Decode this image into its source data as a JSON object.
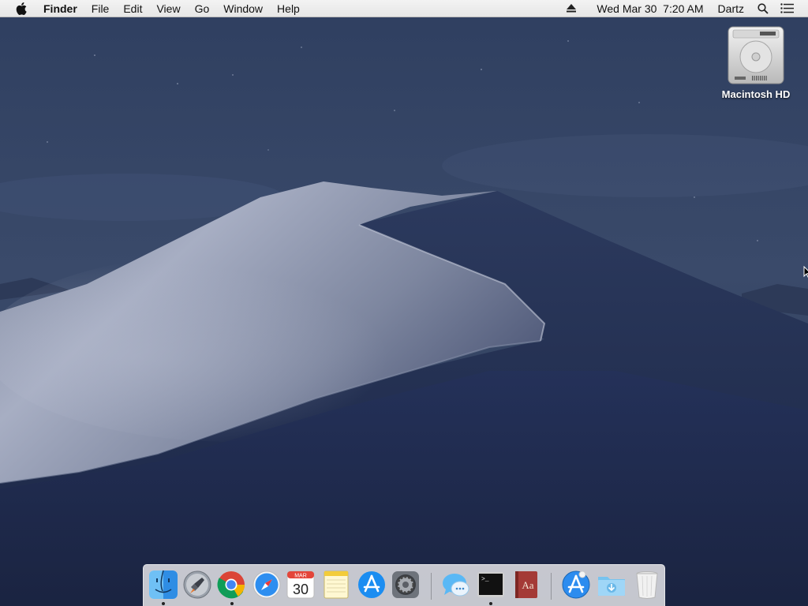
{
  "menubar": {
    "app_name": "Finder",
    "menus": [
      "File",
      "Edit",
      "View",
      "Go",
      "Window",
      "Help"
    ],
    "clock": "Wed Mar 30  7:20 AM",
    "user": "Dartz",
    "icons": [
      "apple-icon",
      "eject-icon",
      "spotlight-search-icon",
      "notification-center-icon"
    ]
  },
  "desktop": {
    "hd_label": "Macintosh HD"
  },
  "dock": {
    "apps": [
      {
        "name": "finder-icon",
        "running": true
      },
      {
        "name": "launchpad-icon",
        "running": false
      },
      {
        "name": "chrome-icon",
        "running": true
      },
      {
        "name": "safari-icon",
        "running": false
      },
      {
        "name": "calendar-icon",
        "running": false
      },
      {
        "name": "notes-icon",
        "running": false
      },
      {
        "name": "app-store-icon",
        "running": false
      },
      {
        "name": "system-preferences-icon",
        "running": false
      },
      {
        "name": "messages-icon",
        "running": false
      },
      {
        "name": "terminal-icon",
        "running": true
      },
      {
        "name": "dictionary-icon",
        "running": false
      },
      {
        "name": "applications-folder-icon",
        "running": false
      },
      {
        "name": "downloads-folder-icon",
        "running": false
      },
      {
        "name": "trash-icon",
        "running": false
      }
    ],
    "calendar": {
      "month": "MAR",
      "day": "30"
    },
    "terminal_prompt": ">_",
    "dictionary_text": "Aa"
  },
  "colors": {
    "sky": "#2a3a5c",
    "dune_light": "#9ea6bd",
    "dune_dark": "#1e2a49"
  }
}
